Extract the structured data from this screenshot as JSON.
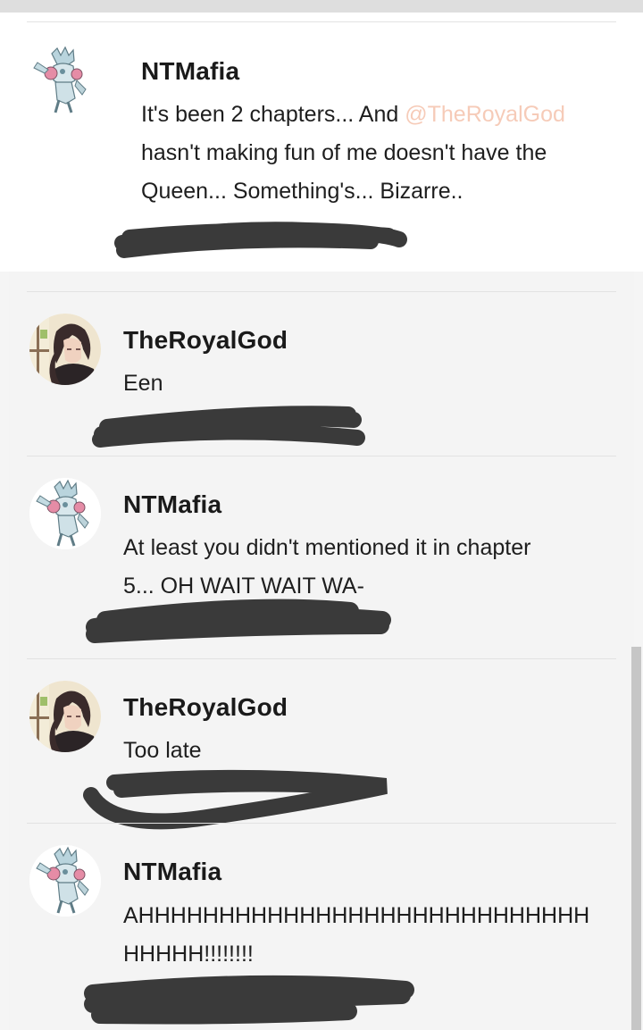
{
  "comments": [
    {
      "author": "NTMafia",
      "avatar_icon": "robot-stand-avatar-icon",
      "lines": [
        "It's been 2 chapters... And ",
        "hasn't making fun of me doesn't have the",
        "Queen... Something's... Bizarre.."
      ],
      "mention": "@TheRoyalGod"
    },
    {
      "author": "TheRoyalGod",
      "avatar_icon": "anime-character-avatar-icon",
      "lines": [
        "Een"
      ]
    },
    {
      "author": "NTMafia",
      "avatar_icon": "robot-stand-avatar-icon",
      "lines": [
        "At least you didn't mentioned it in chapter",
        "5... OH WAIT WAIT WA-"
      ]
    },
    {
      "author": "TheRoyalGod",
      "avatar_icon": "anime-character-avatar-icon",
      "lines": [
        "Too late"
      ]
    },
    {
      "author": "NTMafia",
      "avatar_icon": "robot-stand-avatar-icon",
      "lines": [
        "AHHHHHHHHHHHHHHHHHHHHHHHHHHHH",
        "HHHHH!!!!!!!!"
      ]
    }
  ],
  "colors": {
    "mention": "#f6cbb8",
    "redaction": "#3a3a3a",
    "reply_background": "#f4f4f4",
    "main_background": "#ffffff"
  }
}
